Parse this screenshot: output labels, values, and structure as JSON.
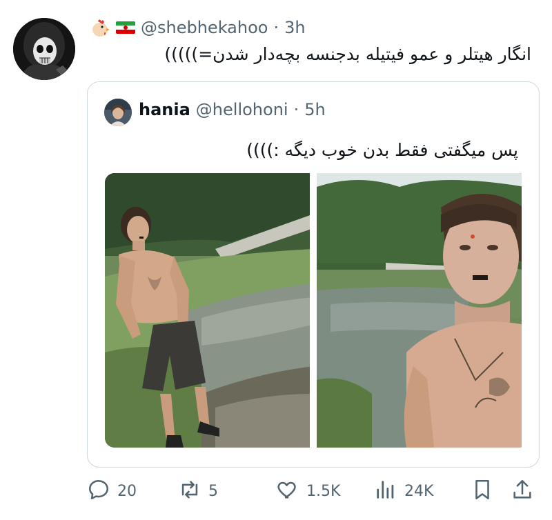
{
  "tweet": {
    "handle": "@shebhekahoo",
    "separator": "·",
    "time": "3h",
    "text": "انگار هیتلر و عمو فیتیله بدجنسه بچه‌دار شدن=)))))",
    "badges": [
      "chick-emoji-icon",
      "iran-flag-icon"
    ]
  },
  "quote": {
    "name": "hania",
    "handle": "@hellohoni",
    "separator": "·",
    "time": "5h",
    "text": "پس میگفتی فقط بدن خوب دیگه :))))",
    "media": [
      "photo-man-lake-full-body",
      "photo-man-lake-selfie"
    ]
  },
  "actions": {
    "replies": "20",
    "reposts": "5",
    "likes": "1.5K",
    "views": "24K"
  },
  "colors": {
    "text": "#0f1419",
    "muted": "#536471",
    "border": "#cfd9de"
  }
}
